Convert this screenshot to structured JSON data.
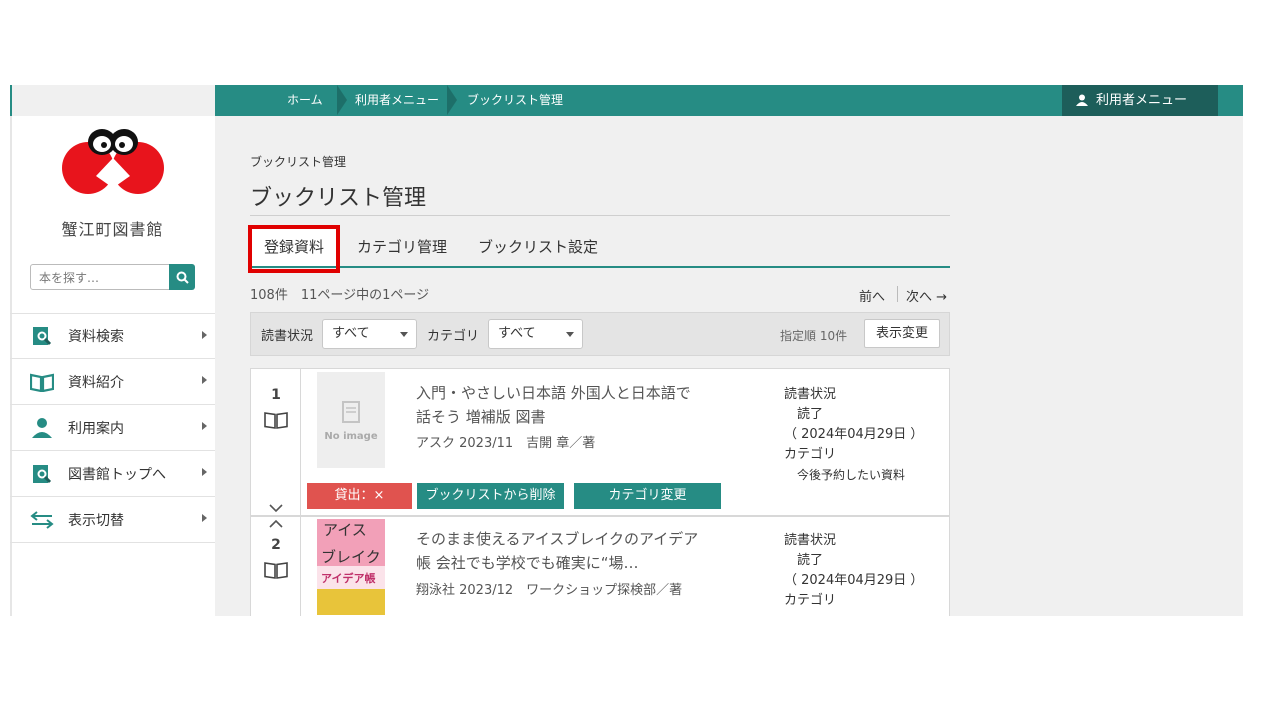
{
  "breadcrumb": [
    {
      "label": "ホーム"
    },
    {
      "label": "利用者メニュー"
    },
    {
      "label": "ブックリスト管理"
    }
  ],
  "header": {
    "user_menu_label": "利用者メニュー"
  },
  "sidebar": {
    "library_name": "蟹江町図書館",
    "search_placeholder": "本を探す…",
    "items": [
      {
        "label": "資料検索",
        "icon": "book-search-icon"
      },
      {
        "label": "資料紹介",
        "icon": "open-book-icon"
      },
      {
        "label": "利用案内",
        "icon": "person-icon"
      },
      {
        "label": "図書館トップへ",
        "icon": "book-search-icon"
      },
      {
        "label": "表示切替",
        "icon": "swap-arrows-icon"
      }
    ]
  },
  "main": {
    "subtitle": "ブックリスト管理",
    "title": "ブックリスト管理",
    "tabs": [
      {
        "label": "登録資料",
        "active": true
      },
      {
        "label": "カテゴリ管理"
      },
      {
        "label": "ブックリスト設定"
      }
    ],
    "count_text": "108件　11ページ中の1ページ",
    "pager": {
      "prev": "前へ",
      "next": "次へ →"
    },
    "filters": {
      "reading_status_label": "読書状況",
      "reading_status_value": "すべて",
      "category_label": "カテゴリ",
      "category_value": "すべて",
      "sort_text": "指定順 10件",
      "display_button": "表示変更"
    },
    "items": [
      {
        "number": "1",
        "cover": "No image",
        "title_line1": "入門・やさしい日本語 外国人と日本語で",
        "title_line2": "話そう 増補版 図書",
        "meta": "アスク 2023/11　吉開 章／著",
        "status_label": "読書状況",
        "status_value": "読了",
        "status_date": "（ 2024年04月29日 ）",
        "category_label": "カテゴリ",
        "category_value": "今後予約したい資料",
        "loan_button": "貸出：×",
        "remove_button": "ブックリストから削除",
        "category_button": "カテゴリ変更"
      },
      {
        "number": "2",
        "title_line1": "そのまま使えるアイスブレイクのアイデア",
        "title_line2": "帳 会社でも学校でも確実に“場…",
        "meta": "翔泳社 2023/12　ワークショップ探検部／著",
        "status_label": "読書状況",
        "status_value": "読了",
        "status_date": "（ 2024年04月29日 ）",
        "category_label": "カテゴリ",
        "cover_text_1": "アイス",
        "cover_text_2": "ブレイク",
        "cover_text_3": "アイデア帳"
      }
    ]
  },
  "colors": {
    "accent": "#268c84",
    "accent_dark": "#1d5e5a",
    "highlight": "#e00000",
    "loan": "#e0534f"
  }
}
